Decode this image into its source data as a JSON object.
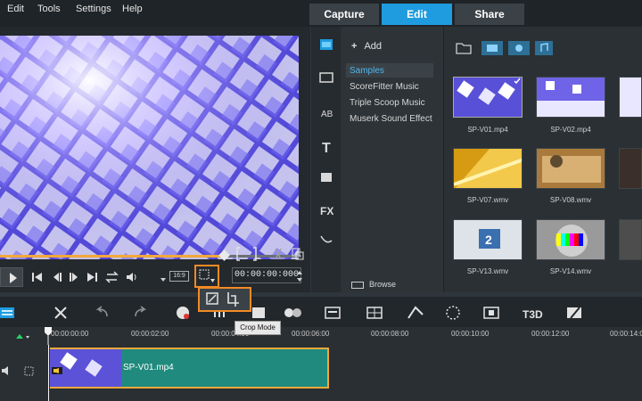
{
  "menu": {
    "items": [
      "Edit",
      "Tools",
      "Settings",
      "Help"
    ]
  },
  "tabs": [
    {
      "label": "Capture"
    },
    {
      "label": "Edit"
    },
    {
      "label": "Share"
    }
  ],
  "preview": {
    "aspect_label": "16:9",
    "timecode": "00:00:00:000"
  },
  "library": {
    "add_label": "Add",
    "list_items": [
      "Samples",
      "ScoreFitter Music",
      "Triple Scoop Music",
      "Muserk Sound Effect"
    ],
    "selected_index": 0,
    "browse_label": "Browse",
    "thumbnails": [
      {
        "label": "SP-V01.mp4"
      },
      {
        "label": "SP-V02.mp4"
      },
      {
        "label": "SP-V07.wmv"
      },
      {
        "label": "SP-V08.wmv"
      },
      {
        "label": "SP-V13.wmv"
      },
      {
        "label": "SP-V14.wmv"
      }
    ]
  },
  "tooltip": {
    "text": "Crop Mode"
  },
  "timeline": {
    "ruler": [
      "00:00:00:00",
      "00:00:02:00",
      "00:00:04:00",
      "00:00:06:00",
      "00:00:08:00",
      "00:00:10:00",
      "00:00:12:00",
      "00:00:14:0"
    ],
    "clip_label": "SP-V01.mp4"
  },
  "colors": {
    "accent": "#1f9ce0",
    "highlight": "#f28a25",
    "clip": "#1f8a7d"
  }
}
